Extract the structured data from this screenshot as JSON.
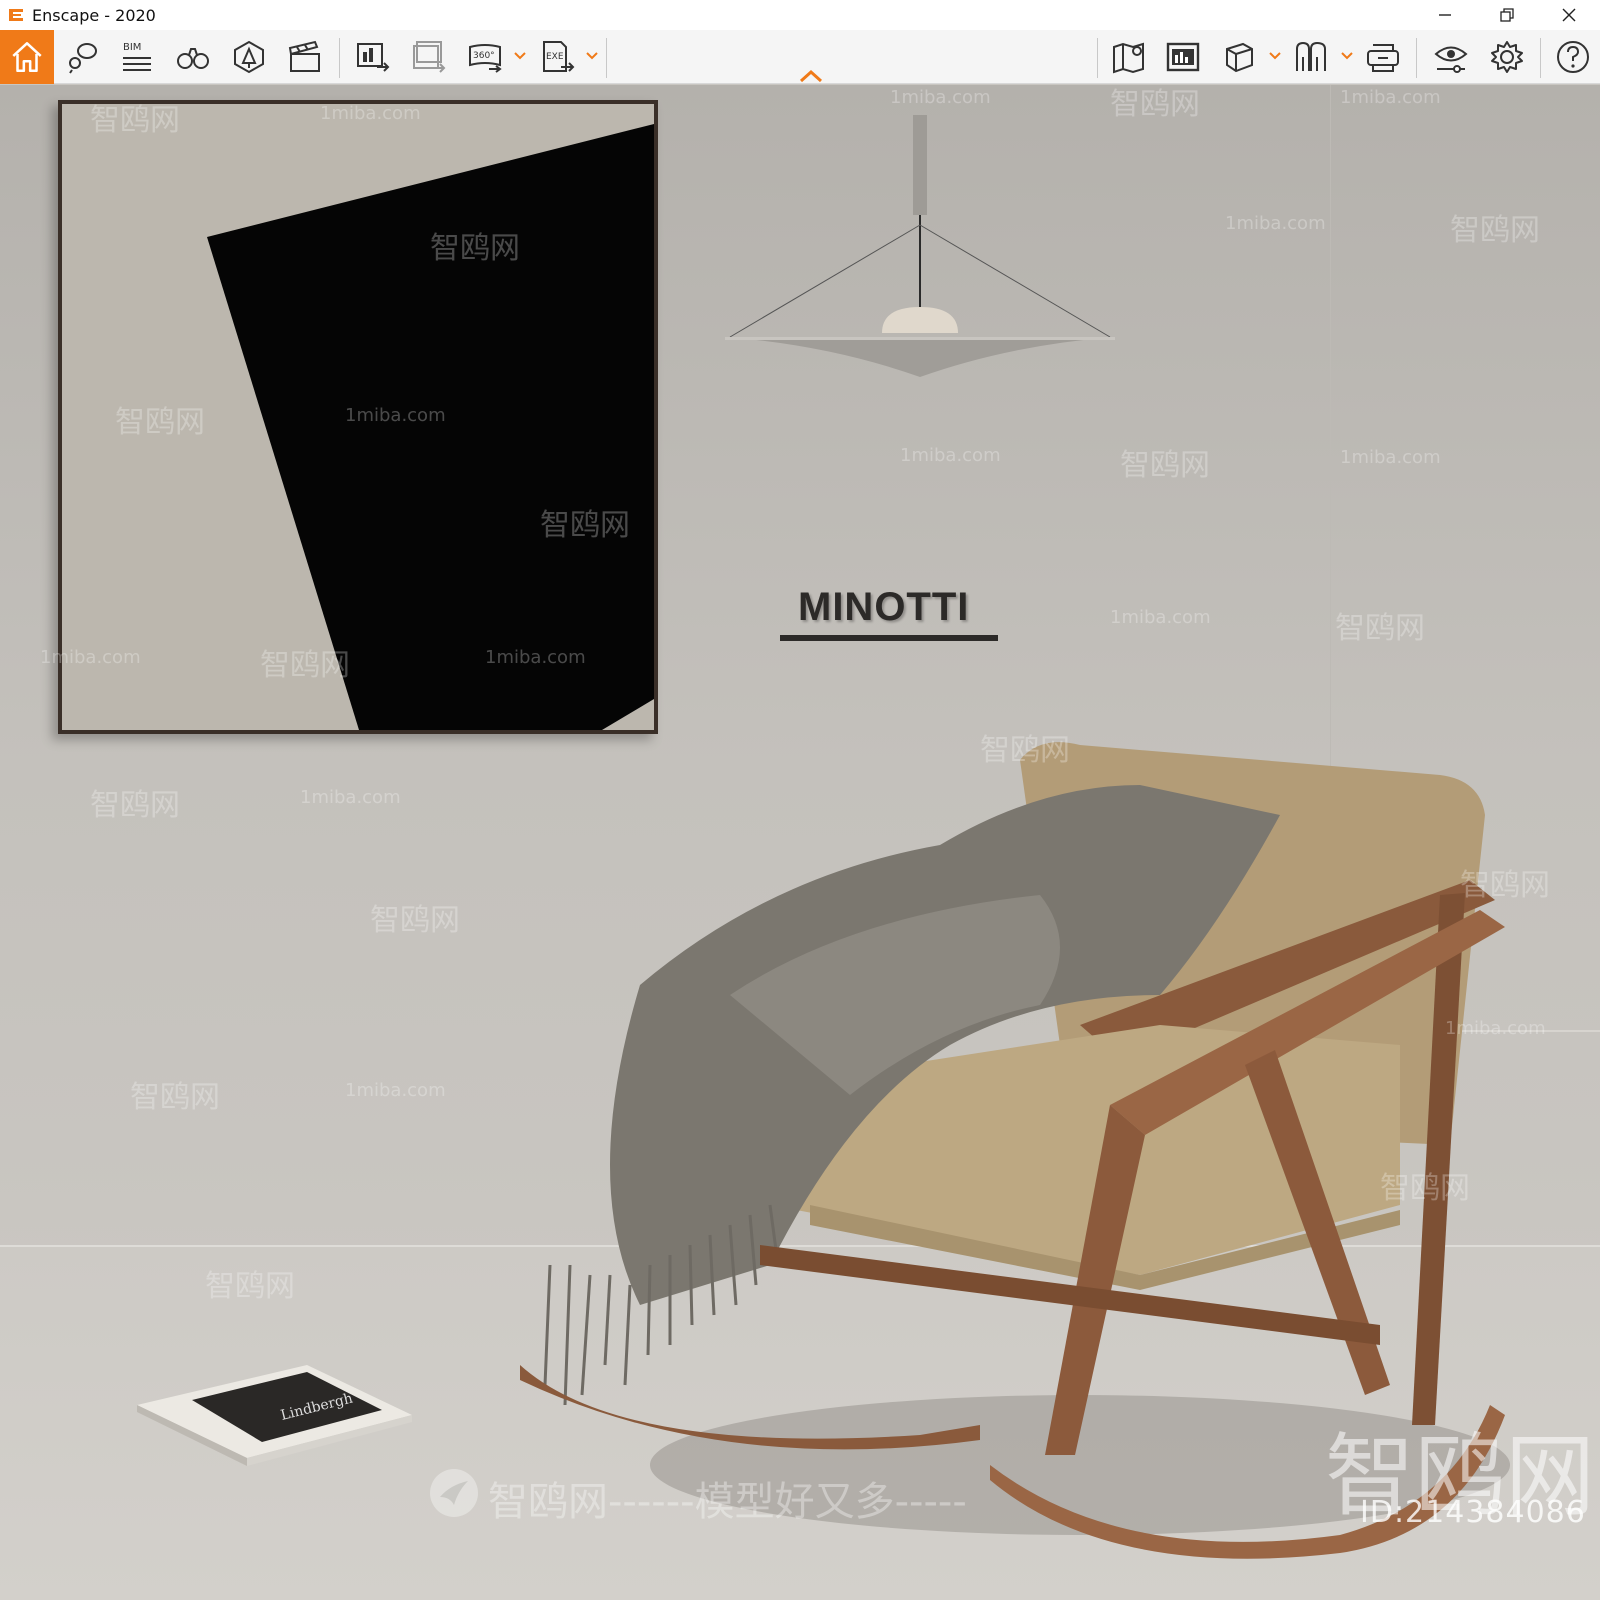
{
  "window": {
    "title": "Enscape - 2020",
    "controls": {
      "minimize": "—",
      "restore": "❐",
      "close": "✕"
    }
  },
  "toolbar": {
    "accent_color": "#f07a18",
    "buttons": [
      {
        "id": "home",
        "icon": "home-icon"
      },
      {
        "id": "views",
        "icon": "views-icon"
      },
      {
        "id": "bim",
        "icon": "bim-icon",
        "label": "BIM"
      },
      {
        "id": "walk",
        "icon": "binoculars-icon"
      },
      {
        "id": "asset",
        "icon": "asset-library-icon"
      },
      {
        "id": "video",
        "icon": "clapperboard-icon"
      },
      {
        "id": "render",
        "icon": "render-image-icon"
      },
      {
        "id": "batch",
        "icon": "batch-render-icon"
      },
      {
        "id": "pano",
        "icon": "panorama-360-icon",
        "label": "360°"
      },
      {
        "id": "export",
        "icon": "export-exe-icon",
        "label": "EXE"
      },
      {
        "id": "map",
        "icon": "map-icon"
      },
      {
        "id": "gallery",
        "icon": "gallery-icon"
      },
      {
        "id": "cube",
        "icon": "cube-icon"
      },
      {
        "id": "sync",
        "icon": "sync-views-icon"
      },
      {
        "id": "vr",
        "icon": "vr-headset-icon"
      },
      {
        "id": "visual",
        "icon": "eye-settings-icon"
      },
      {
        "id": "settings",
        "icon": "gear-icon"
      },
      {
        "id": "help",
        "icon": "help-icon"
      }
    ]
  },
  "scene": {
    "sign": "MINOTTI",
    "magazine_title": "Lindbergh",
    "watermark_brand": "智鸥网",
    "watermark_url": "1miba.com",
    "watermark_dashes": "------",
    "watermark_slogan": "智鸥网------模型好又多-----",
    "watermark_id": "ID:214384086"
  }
}
